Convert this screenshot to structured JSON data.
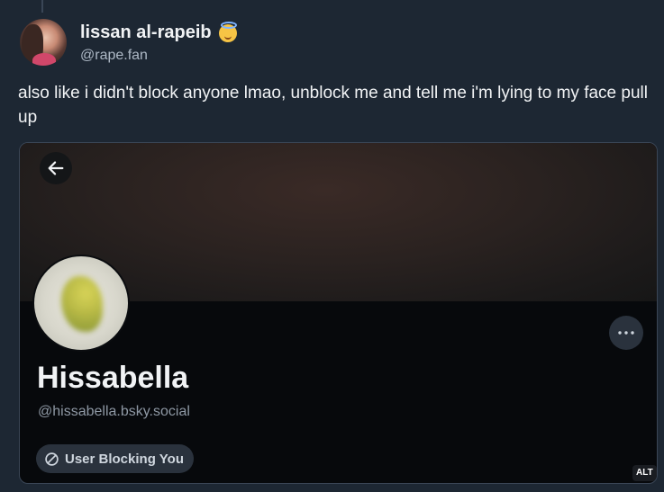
{
  "post": {
    "author": {
      "display_name": "lissan al-rapeib",
      "badge_icon": "angel-face-emoji-icon",
      "handle": "@rape.fan"
    },
    "text": "also like i didn't block anyone lmao, unblock me and tell me i'm lying to my face pull up"
  },
  "embed": {
    "back_icon": "arrow-left-icon",
    "more_icon": "ellipsis-icon",
    "profile": {
      "display_name": "Hissabella",
      "handle": "@hissabella.bsky.social"
    },
    "status_pill": {
      "icon": "block-icon",
      "label": "User Blocking You"
    },
    "alt_label": "ALT"
  },
  "colors": {
    "page_background": "#1d2733",
    "embed_background": "#07090c",
    "pill_background": "#2a323d"
  }
}
